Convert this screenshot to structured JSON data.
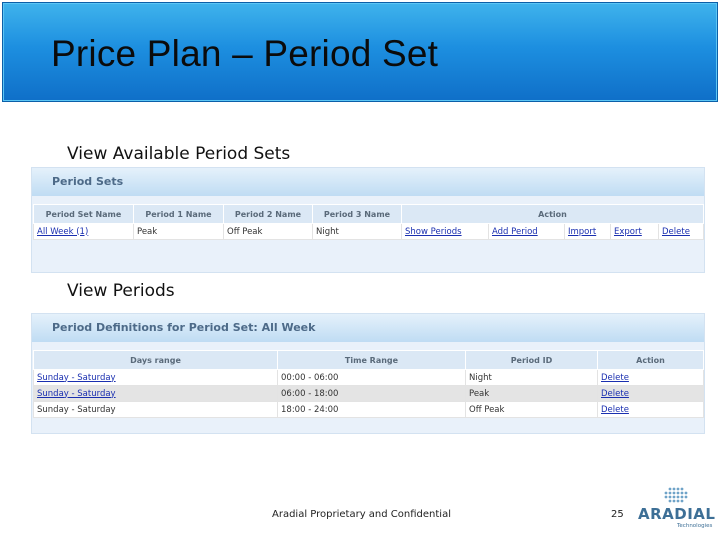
{
  "slide": {
    "title": "Price Plan – Period Set",
    "caption1": "View Available Period Sets",
    "caption2": "View Periods",
    "footer": "Aradial Proprietary and Confidential",
    "page_number": "25",
    "logo_text": "ARADIAL",
    "logo_sub": "Technologies"
  },
  "period_sets_panel": {
    "title": "Period Sets",
    "columns": [
      "Period Set Name",
      "Period 1 Name",
      "Period 2 Name",
      "Period 3 Name",
      "Action"
    ],
    "row": {
      "name": "All Week (1)",
      "p1": "Peak",
      "p2": "Off Peak",
      "p3": "Night",
      "actions": [
        "Show Periods",
        "Add Period",
        "Import",
        "Export",
        "Delete"
      ]
    }
  },
  "period_defs_panel": {
    "title": "Period Definitions for Period Set: All Week",
    "columns": [
      "Days range",
      "Time Range",
      "Period ID",
      "Action"
    ],
    "rows": [
      {
        "days": "Sunday - Saturday",
        "time": "00:00 - 06:00",
        "period": "Night",
        "action": "Delete"
      },
      {
        "days": "Sunday - Saturday",
        "time": "06:00 - 18:00",
        "period": "Peak",
        "action": "Delete"
      },
      {
        "days": "Sunday - Saturday",
        "time": "18:00 - 24:00",
        "period": "Off Peak",
        "action": "Delete"
      }
    ]
  },
  "colors": {
    "banner": "#1d8fe0",
    "panel_bg": "#e9f1fa",
    "header_text": "#4d6a88",
    "link": "#1a2fb0"
  }
}
